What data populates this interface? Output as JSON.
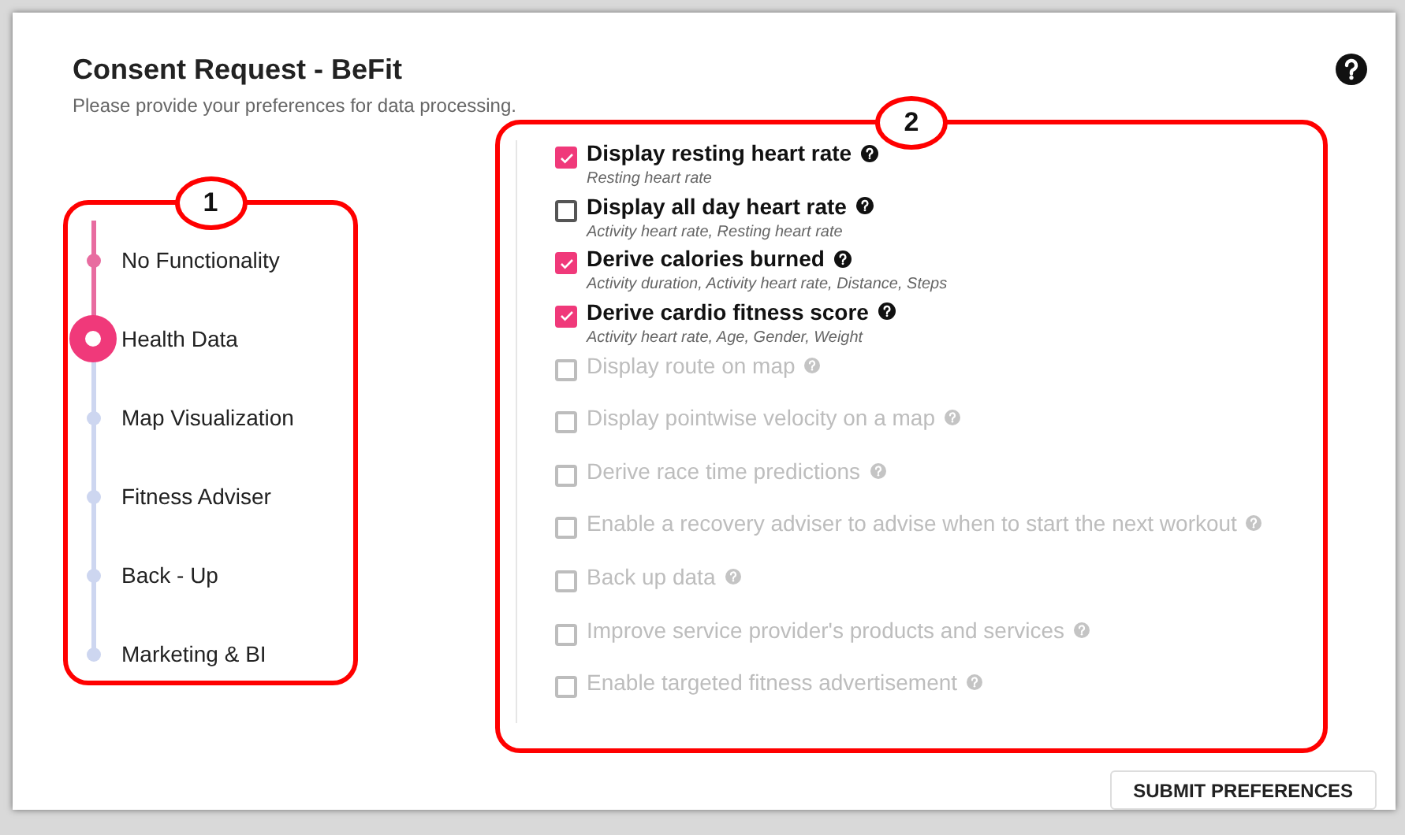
{
  "title": "Consent Request - BeFit",
  "subtitle": "Please provide your preferences for data processing.",
  "annotations": [
    {
      "label": "1"
    },
    {
      "label": "2"
    }
  ],
  "steps": [
    {
      "label": "No Functionality",
      "completed": true,
      "selected": false
    },
    {
      "label": "Health Data",
      "completed": false,
      "selected": true
    },
    {
      "label": "Map Visualization",
      "completed": false,
      "selected": false
    },
    {
      "label": "Fitness Adviser",
      "completed": false,
      "selected": false
    },
    {
      "label": "Back - Up",
      "completed": false,
      "selected": false
    },
    {
      "label": "Marketing & BI",
      "completed": false,
      "selected": false
    }
  ],
  "options": [
    {
      "label": "Display resting heart rate",
      "details": "Resting heart rate",
      "checked": true,
      "disabled": false
    },
    {
      "label": "Display all day heart rate",
      "details": "Activity heart rate, Resting heart rate",
      "checked": false,
      "disabled": false
    },
    {
      "label": "Derive calories burned",
      "details": "Activity duration, Activity heart rate, Distance, Steps",
      "checked": true,
      "disabled": false
    },
    {
      "label": "Derive cardio fitness score",
      "details": "Activity heart rate, Age, Gender, Weight",
      "checked": true,
      "disabled": false
    },
    {
      "label": "Display route on map",
      "checked": false,
      "disabled": true
    },
    {
      "label": "Display pointwise velocity on a map",
      "checked": false,
      "disabled": true
    },
    {
      "label": "Derive race time predictions",
      "checked": false,
      "disabled": true
    },
    {
      "label": "Enable a recovery adviser to advise when to start the next workout",
      "checked": false,
      "disabled": true
    },
    {
      "label": "Back up data",
      "checked": false,
      "disabled": true
    },
    {
      "label": "Improve service provider's products and services",
      "checked": false,
      "disabled": true
    },
    {
      "label": "Enable targeted fitness advertisement",
      "checked": false,
      "disabled": true
    }
  ],
  "submit": "SUBMIT PREFERENCES"
}
